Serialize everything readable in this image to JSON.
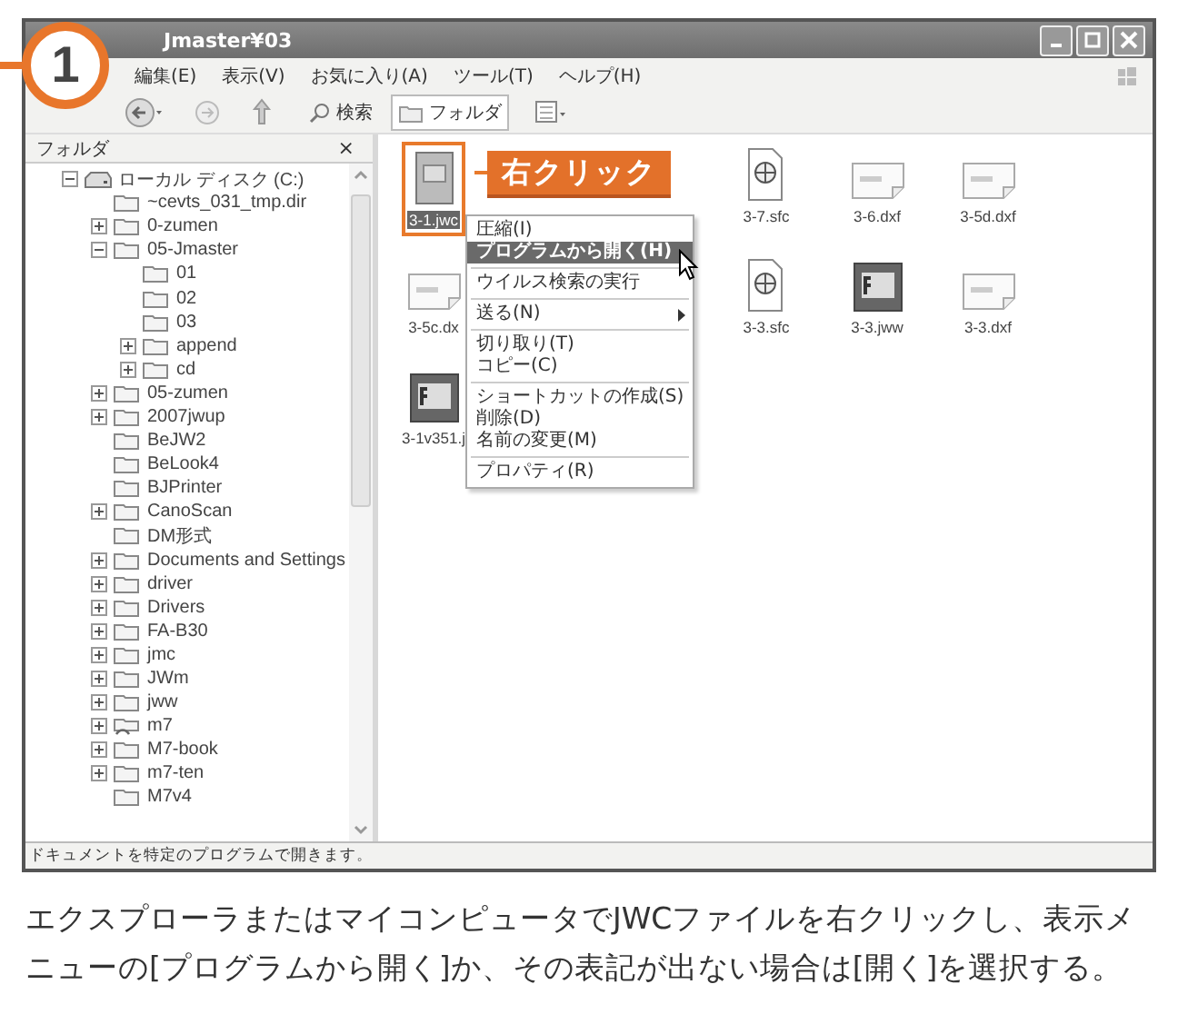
{
  "step_badge": "1",
  "window": {
    "title": "Jmaster¥03"
  },
  "menu_bar": [
    "編集(E)",
    "表示(V)",
    "お気に入り(A)",
    "ツール(T)",
    "ヘルプ(H)"
  ],
  "toolbar": [
    {
      "kind": "back",
      "selected": false
    },
    {
      "kind": "forward",
      "selected": false
    },
    {
      "kind": "up",
      "selected": false
    },
    {
      "kind": "search",
      "label": "検索",
      "selected": false
    },
    {
      "kind": "folders",
      "label": "フォルダ",
      "selected": true
    },
    {
      "kind": "views",
      "selected": false
    }
  ],
  "folder_pane": {
    "title": "フォルダ",
    "close": "×",
    "tree": [
      {
        "label": "ローカル ディスク (C:)",
        "kind": "drive",
        "expanded": true,
        "children": [
          {
            "label": "~cevts_031_tmp.dir",
            "kind": "folder"
          },
          {
            "label": "0-zumen",
            "kind": "folder",
            "expanded": false
          },
          {
            "label": "05-Jmaster",
            "kind": "folder",
            "expanded": true,
            "children": [
              {
                "label": "01",
                "kind": "folder"
              },
              {
                "label": "02",
                "kind": "folder"
              },
              {
                "label": "03",
                "kind": "folder"
              },
              {
                "label": "append",
                "kind": "folder",
                "expanded": false
              },
              {
                "label": "cd",
                "kind": "folder",
                "expanded": false
              }
            ]
          },
          {
            "label": "05-zumen",
            "kind": "folder",
            "expanded": false
          },
          {
            "label": "2007jwup",
            "kind": "folder",
            "expanded": false
          },
          {
            "label": "BeJW2",
            "kind": "folder"
          },
          {
            "label": "BeLook4",
            "kind": "folder"
          },
          {
            "label": "BJPrinter",
            "kind": "folder"
          },
          {
            "label": "CanoScan",
            "kind": "folder",
            "expanded": false
          },
          {
            "label": "DM形式",
            "kind": "folder"
          },
          {
            "label": "Documents and Settings",
            "kind": "folder",
            "expanded": false
          },
          {
            "label": "driver",
            "kind": "folder",
            "expanded": false
          },
          {
            "label": "Drivers",
            "kind": "folder",
            "expanded": false
          },
          {
            "label": "FA-B30",
            "kind": "folder",
            "expanded": false
          },
          {
            "label": "jmc",
            "kind": "folder",
            "expanded": false
          },
          {
            "label": "JWm",
            "kind": "folder",
            "expanded": false
          },
          {
            "label": "jww",
            "kind": "folder",
            "expanded": false
          },
          {
            "label": "m7",
            "kind": "shared",
            "expanded": false
          },
          {
            "label": "M7-book",
            "kind": "folder",
            "expanded": false
          },
          {
            "label": "m7-ten",
            "kind": "folder",
            "expanded": false
          },
          {
            "label": "M7v4",
            "kind": "folder"
          }
        ]
      }
    ]
  },
  "files": [
    [
      {
        "name": "3-1.jwc",
        "kind": "jwc",
        "selected": true
      },
      {
        "name": "3-7.sfc",
        "kind": "sfc",
        "selected": false
      },
      {
        "name": "3-6.dxf",
        "kind": "dxf",
        "selected": false
      },
      {
        "name": "3-5d.dxf",
        "kind": "dxf",
        "selected": false
      }
    ],
    [
      {
        "name": "3-5c.dx",
        "kind": "dxf",
        "selected": false
      },
      {
        "name": "3-3.sfc",
        "kind": "sfc",
        "selected": false
      },
      {
        "name": "3-3.jww",
        "kind": "jww",
        "selected": false
      },
      {
        "name": "3-3.dxf",
        "kind": "dxf",
        "selected": false
      }
    ],
    [
      {
        "name": "3-1v351.j",
        "kind": "jww",
        "selected": false
      }
    ]
  ],
  "callout": "右クリック",
  "context_menu": [
    {
      "kind": "item",
      "label": "圧縮(I)",
      "selected": false,
      "submenu": false
    },
    {
      "kind": "item",
      "label": "プログラムから開く(H)",
      "selected": true,
      "submenu": false
    },
    {
      "kind": "separator"
    },
    {
      "kind": "item",
      "label": "ウイルス検索の実行",
      "selected": false,
      "submenu": false
    },
    {
      "kind": "separator"
    },
    {
      "kind": "item",
      "label": "送る(N)",
      "selected": false,
      "submenu": true
    },
    {
      "kind": "separator"
    },
    {
      "kind": "item",
      "label": "切り取り(T)",
      "selected": false,
      "submenu": false
    },
    {
      "kind": "item",
      "label": "コピー(C)",
      "selected": false,
      "submenu": false
    },
    {
      "kind": "separator"
    },
    {
      "kind": "item",
      "label": "ショートカットの作成(S)",
      "selected": false,
      "submenu": false
    },
    {
      "kind": "item",
      "label": "削除(D)",
      "selected": false,
      "submenu": false
    },
    {
      "kind": "item",
      "label": "名前の変更(M)",
      "selected": false,
      "submenu": false
    },
    {
      "kind": "separator"
    },
    {
      "kind": "item",
      "label": "プロパティ(R)",
      "selected": false,
      "submenu": false
    }
  ],
  "status_bar": "ドキュメントを特定のプログラムで開きます。",
  "caption": [
    "エクスプローラまたはマイコンピュータでJWCファイルを右クリックし、表示メ",
    "ニューの[プログラムから開く]か、その表記が出ない場合は[開く]を選択する。"
  ]
}
